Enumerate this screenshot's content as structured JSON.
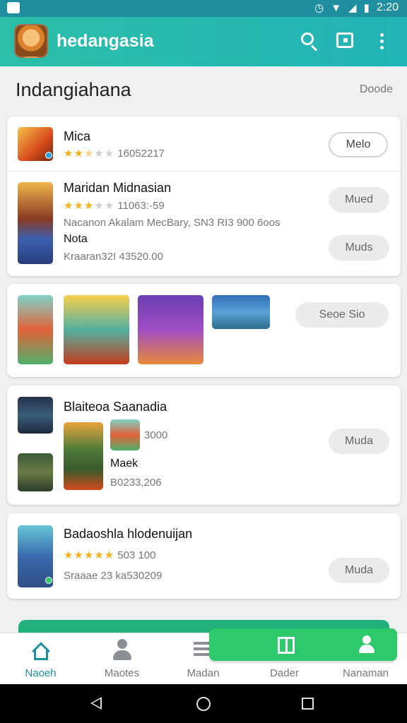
{
  "status_bar": {
    "time": "2:20"
  },
  "app_bar": {
    "title": "hedangasia"
  },
  "section": {
    "title": "Indangiahana",
    "link": "Doode"
  },
  "cards": {
    "c1": {
      "title": "Mica",
      "rating_text": "16052217",
      "button": "Melo"
    },
    "c2": {
      "title": "Maridan Midnasian",
      "rating_text": "11063:-59",
      "desc": "Nacanon Akalam MecBary, SN3 RI3 900 6oos",
      "meta": "Nota",
      "price": "Kraaran32I 43520.00",
      "button1": "Mued",
      "button2": "Muds"
    },
    "c3": {
      "button": "Seoe Sio"
    },
    "c4": {
      "title": "Blaiteoa Saanadia",
      "value": "3000",
      "meta": "Maek",
      "price": "B0233,206",
      "button": "Muda"
    },
    "c5": {
      "title": "Badaoshla hlodenuijan",
      "rating_text": "503 100",
      "price": "Sraaae 23 ka530209",
      "button": "Muda"
    }
  },
  "bottom_nav": {
    "items": [
      {
        "label": "Naoeh"
      },
      {
        "label": "Maotes"
      },
      {
        "label": "Madan"
      },
      {
        "label": "Dader"
      },
      {
        "label": "Nanaman"
      }
    ]
  },
  "colors": {
    "accent": "#22b3b6",
    "green": "#2dc96a",
    "star": "#f3b21c"
  },
  "ratings": {
    "c1": 2.5,
    "c2": 3,
    "c5": 5
  }
}
